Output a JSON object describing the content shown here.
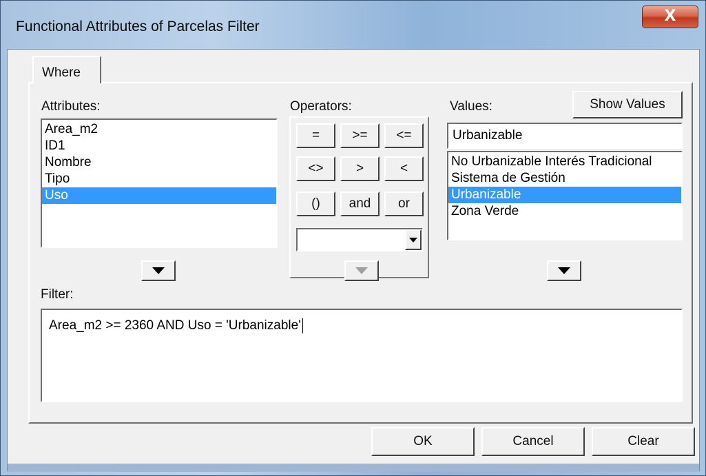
{
  "window": {
    "title": "Functional Attributes of Parcelas Filter",
    "close_label": "X"
  },
  "tabs": [
    {
      "label": "Where"
    }
  ],
  "attributes": {
    "label": "Attributes:",
    "items": [
      "Area_m2",
      "ID1",
      "Nombre",
      "Tipo",
      "Uso"
    ],
    "selected": "Uso"
  },
  "operators": {
    "label": "Operators:",
    "buttons": [
      "=",
      ">=",
      "<=",
      "<>",
      ">",
      "<",
      "()",
      "and",
      "or"
    ],
    "combo_value": ""
  },
  "values": {
    "label": "Values:",
    "show_values_label": "Show Values",
    "current_value": "Urbanizable",
    "items": [
      "No Urbanizable Interés Tradicional",
      "Sistema de Gestión",
      "Urbanizable",
      "Zona Verde"
    ],
    "selected": "Urbanizable"
  },
  "filter": {
    "label": "Filter:",
    "expression": "Area_m2  >= 2360 AND  Uso  =  'Urbanizable'"
  },
  "footer": {
    "ok_label": "OK",
    "cancel_label": "Cancel",
    "clear_label": "Clear"
  },
  "icons": {
    "close": "close-icon",
    "down_arrow": "down-arrow-icon"
  }
}
